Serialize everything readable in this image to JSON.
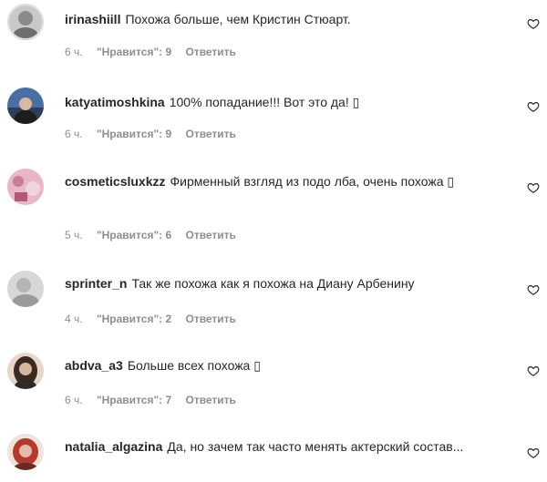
{
  "comments": [
    {
      "username": "irinashiill",
      "text": "Похожа больше, чем Кристин Стюарт.",
      "time": "6 ч.",
      "likes": "\"Нравится\": 9",
      "reply": "Ответить"
    },
    {
      "username": "katyatimoshkina",
      "text": "100% попадание!!! Вот это да! ▯",
      "time": "6 ч.",
      "likes": "\"Нравится\": 9",
      "reply": "Ответить"
    },
    {
      "username": "cosmeticsluxkzz",
      "text": "Фирменный взгляд из подо лба, очень похожа ▯",
      "time": "5 ч.",
      "likes": "\"Нравится\": 6",
      "reply": "Ответить"
    },
    {
      "username": "sprinter_n",
      "text": "Так же похожа как я похожа на Диану Арбенину",
      "time": "4 ч.",
      "likes": "\"Нравится\": 2",
      "reply": "Ответить"
    },
    {
      "username": "abdva_a3",
      "text": "Больше всех похожа ▯",
      "time": "6 ч.",
      "likes": "\"Нравится\": 7",
      "reply": "Ответить"
    },
    {
      "username": "natalia_algazina",
      "text": "Да, но зачем так часто менять актерский состав...",
      "time": "",
      "likes": "",
      "reply": ""
    }
  ],
  "icons": {
    "like": "heart-outline-icon"
  },
  "colors": {
    "text": "#262626",
    "meta": "#8e8e8e"
  }
}
